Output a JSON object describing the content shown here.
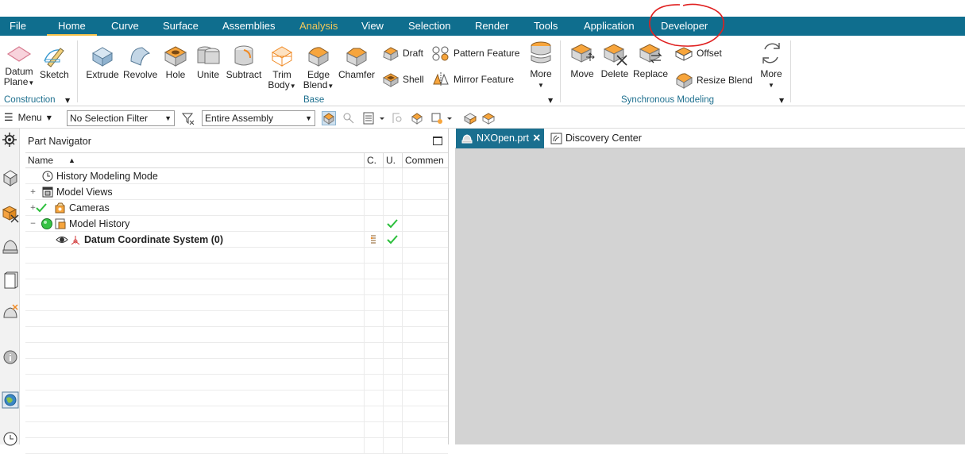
{
  "menubar": {
    "tabs": [
      "File",
      "Home",
      "Curve",
      "Surface",
      "Assemblies",
      "Analysis",
      "View",
      "Selection",
      "Render",
      "Tools",
      "Application",
      "Developer"
    ],
    "active_tab": "Home",
    "highlight_tab": "Analysis",
    "colors": {
      "bar": "#0f6e8e",
      "accent": "#f5c24b"
    }
  },
  "ribbon": {
    "construction": {
      "datum_plane": "Datum\nPlane",
      "sketch": "Sketch",
      "group_label": "Construction"
    },
    "base": {
      "extrude": "Extrude",
      "revolve": "Revolve",
      "hole": "Hole",
      "unite": "Unite",
      "subtract": "Subtract",
      "trim_body": "Trim\nBody",
      "edge_blend": "Edge\nBlend",
      "chamfer": "Chamfer",
      "draft": "Draft",
      "shell": "Shell",
      "pattern_feature": "Pattern Feature",
      "mirror_feature": "Mirror Feature",
      "more": "More",
      "group_label": "Base"
    },
    "sync": {
      "move": "Move",
      "delete": "Delete",
      "replace": "Replace",
      "offset": "Offset",
      "resize_blend": "Resize Blend",
      "more": "More",
      "group_label": "Synchronous Modeling"
    }
  },
  "selection_bar": {
    "menu_label": "Menu",
    "filter_value": "No Selection Filter",
    "scope_value": "Entire Assembly"
  },
  "part_navigator": {
    "title": "Part Navigator",
    "columns": [
      "Name",
      "C.",
      "U.",
      "Commen"
    ],
    "rows": [
      {
        "label": "History Modeling Mode"
      },
      {
        "label": "Model Views"
      },
      {
        "label": "Cameras"
      },
      {
        "label": "Model History"
      },
      {
        "label": "Datum Coordinate System (0)"
      }
    ]
  },
  "document_tabs": {
    "active": "NXOpen.prt",
    "other": "Discovery Center"
  }
}
